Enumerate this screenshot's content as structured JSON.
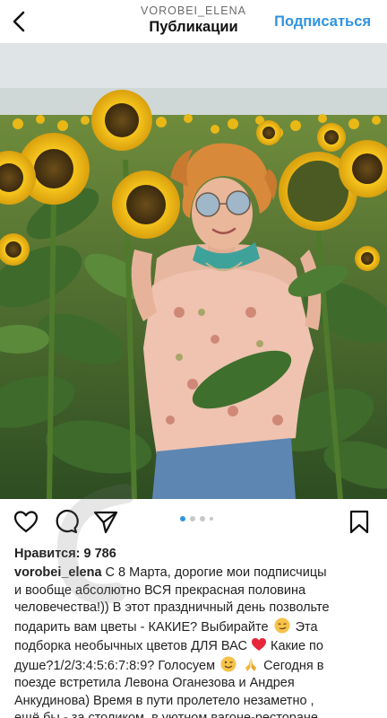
{
  "header": {
    "username": "VOROBEI_ELENA",
    "title": "Публикации",
    "follow_label": "Подписаться"
  },
  "post": {
    "likes_text": "Нравится: 9 786",
    "carousel": {
      "count": 4,
      "active_index": 0
    },
    "caption": {
      "username": "vorobei_elena",
      "line1_rest": "С 8 Марта, дорогие мои подписчицы",
      "line2": "и вообще абсолютно ВСЯ прекрасная половина",
      "line3": "человечества!)) В этот праздничный день позвольте",
      "line4": "подарить вам цветы - КАКИЕ? Выбирайте",
      "line4_tail": "Эта",
      "line5": "подборка необычных цветов ДЛЯ ВАС",
      "line5_tail": "Какие по",
      "line6": "душе?1/2/3:4:5:6:7:8:9? Голосуем",
      "line6_tail": "Сегодня в",
      "line7": "поезде встретила Левона Оганезова и Андрея",
      "line8": "Анкудинова) Время в пути пролетело незаметно ,",
      "line9": "ещё бы - за столиком, в уютном вагоне-ресторане"
    }
  },
  "colors": {
    "accent": "#2f93df",
    "sky": "#dfe6e8",
    "leaf": "#3f6b2e",
    "petal": "#f2c21a"
  },
  "icons": {
    "back": "chevron-left-icon",
    "like": "heart-icon",
    "comment": "comment-icon",
    "share": "send-icon",
    "save": "bookmark-icon"
  }
}
